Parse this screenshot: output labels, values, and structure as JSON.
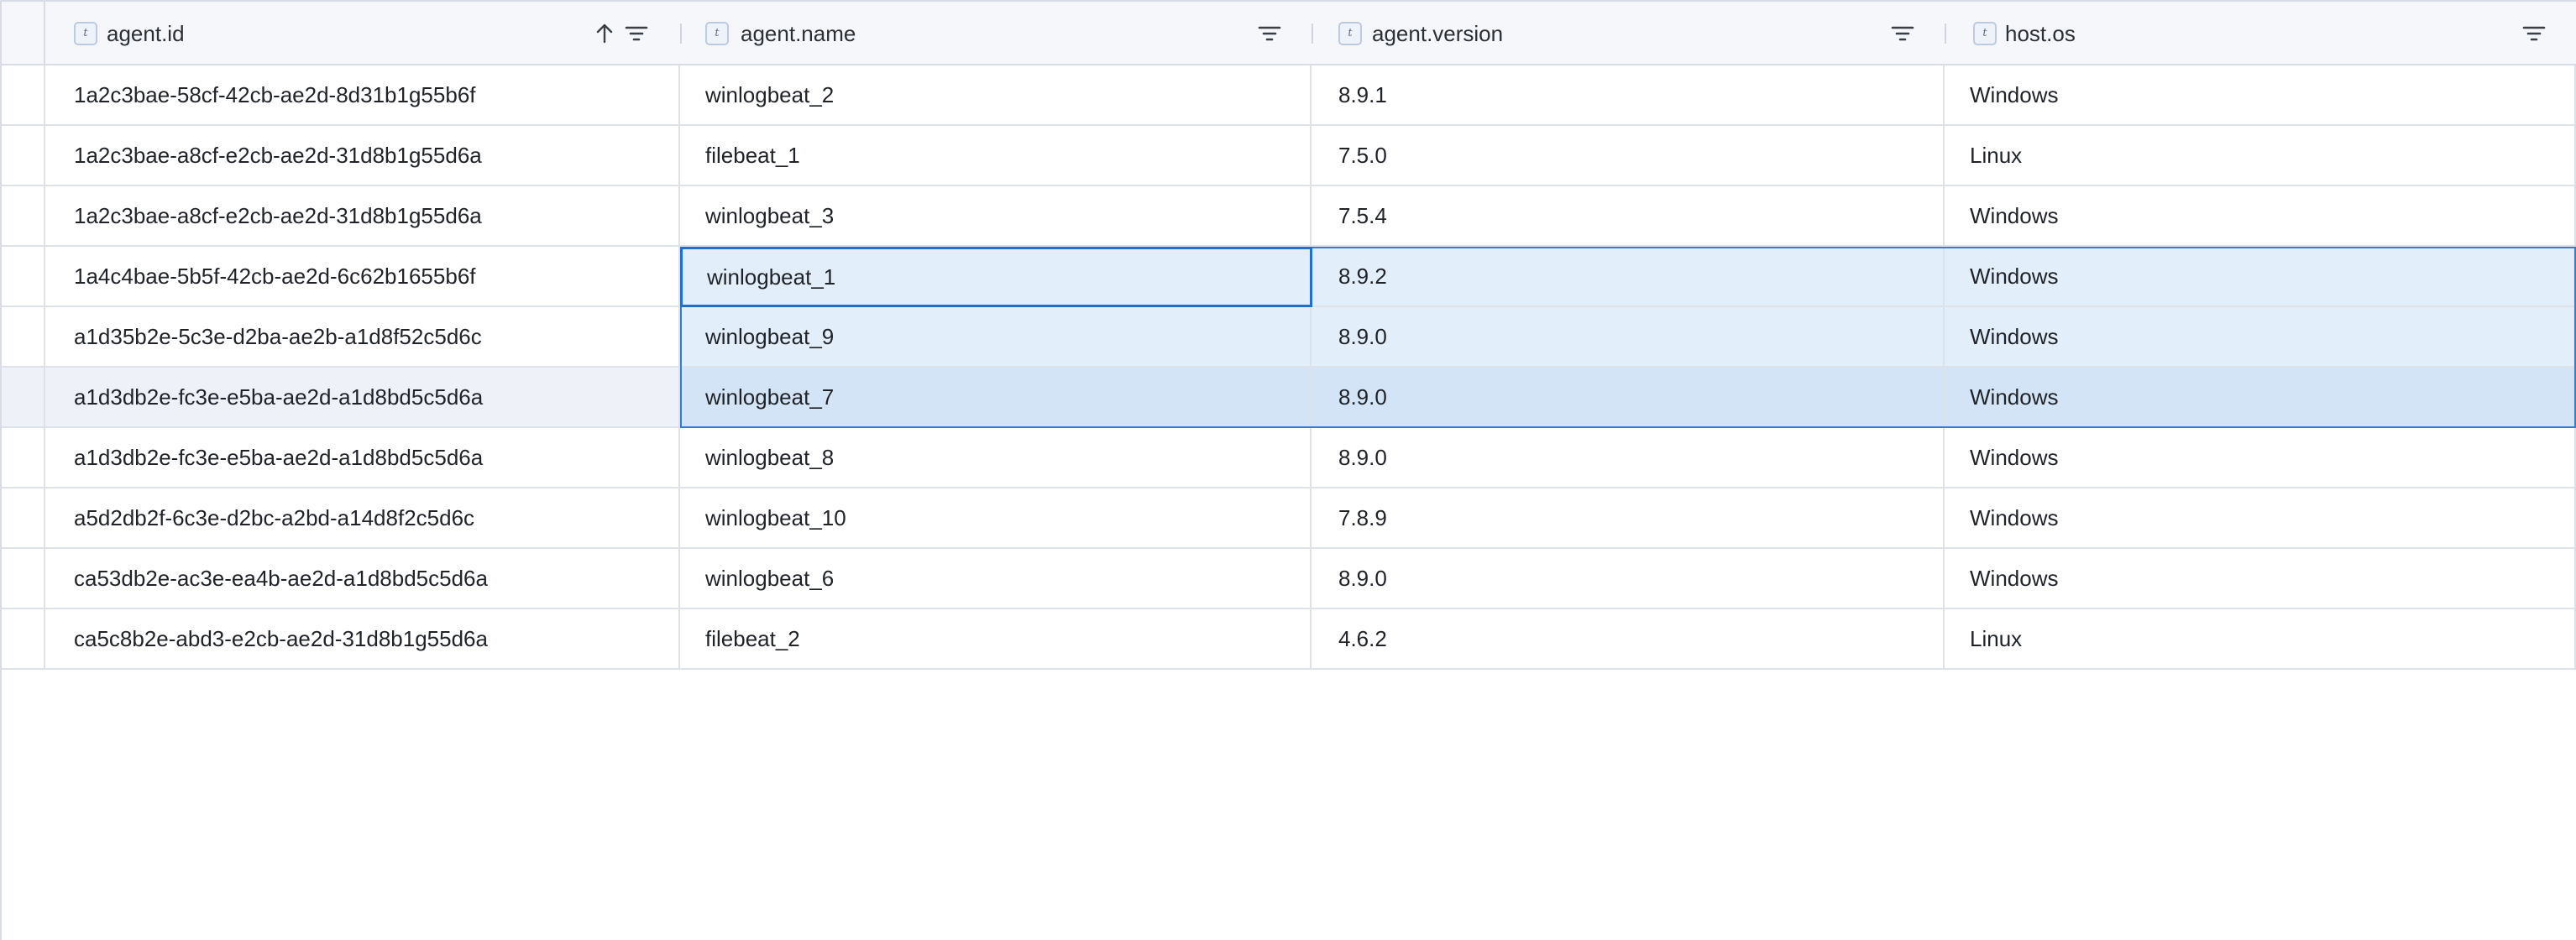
{
  "columns": [
    {
      "type_badge": "t",
      "label": "agent.id",
      "sort_icon": "arrow-up-icon",
      "filter_icon": "filter-icon"
    },
    {
      "type_badge": "t",
      "label": "agent.name",
      "filter_icon": "filter-icon"
    },
    {
      "type_badge": "t",
      "label": "agent.version",
      "filter_icon": "filter-icon"
    },
    {
      "type_badge": "t",
      "label": "host.os",
      "filter_icon": "filter-icon"
    }
  ],
  "rows": [
    {
      "agent_id": "1a2c3bae-58cf-42cb-ae2d-8d31b1g55b6f",
      "agent_name": "winlogbeat_2",
      "agent_version": "8.9.1",
      "host_os": "Windows"
    },
    {
      "agent_id": "1a2c3bae-a8cf-e2cb-ae2d-31d8b1g55d6a",
      "agent_name": "filebeat_1",
      "agent_version": "7.5.0",
      "host_os": "Linux"
    },
    {
      "agent_id": "1a2c3bae-a8cf-e2cb-ae2d-31d8b1g55d6a",
      "agent_name": "winlogbeat_3",
      "agent_version": "7.5.4",
      "host_os": "Windows"
    },
    {
      "agent_id": "1a4c4bae-5b5f-42cb-ae2d-6c62b1655b6f",
      "agent_name": "winlogbeat_1",
      "agent_version": "8.9.2",
      "host_os": "Windows"
    },
    {
      "agent_id": "a1d35b2e-5c3e-d2ba-ae2b-a1d8f52c5d6c",
      "agent_name": "winlogbeat_9",
      "agent_version": "8.9.0",
      "host_os": "Windows"
    },
    {
      "agent_id": "a1d3db2e-fc3e-e5ba-ae2d-a1d8bd5c5d6a",
      "agent_name": "winlogbeat_7",
      "agent_version": "8.9.0",
      "host_os": "Windows"
    },
    {
      "agent_id": "a1d3db2e-fc3e-e5ba-ae2d-a1d8bd5c5d6a",
      "agent_name": "winlogbeat_8",
      "agent_version": "8.9.0",
      "host_os": "Windows"
    },
    {
      "agent_id": "a5d2db2f-6c3e-d2bc-a2bd-a14d8f2c5d6c",
      "agent_name": "winlogbeat_10",
      "agent_version": "7.8.9",
      "host_os": "Windows"
    },
    {
      "agent_id": "ca53db2e-ac3e-ea4b-ae2d-a1d8bd5c5d6a",
      "agent_name": "winlogbeat_6",
      "agent_version": "8.9.0",
      "host_os": "Windows"
    },
    {
      "agent_id": "ca5c8b2e-abd3-e2cb-ae2d-31d8b1g55d6a",
      "agent_name": "filebeat_2",
      "agent_version": "4.6.2",
      "host_os": "Linux"
    }
  ],
  "selection": {
    "rows": [
      3,
      4,
      5
    ],
    "active_row": 3,
    "active_column": "agent.name",
    "highlighted_row": 5
  },
  "colors": {
    "selection_fill": "#e3eefb",
    "selection_fill_strong": "#d4e4f7",
    "selection_border": "#2f7fd9",
    "grid_line": "#dde1e8",
    "header_bg": "#f5f7fb"
  }
}
